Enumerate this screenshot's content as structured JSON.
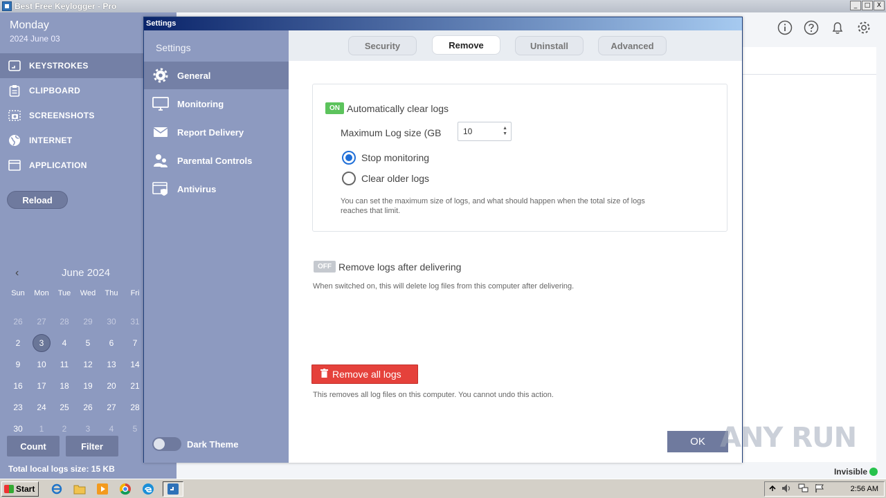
{
  "window": {
    "title": "Best Free Keylogger - Pro",
    "min": "_",
    "max": "□",
    "close": "X"
  },
  "sidebar": {
    "day": "Monday",
    "date": "2024 June 03",
    "items": [
      {
        "label": "KEYSTROKES",
        "icon": "keyboard-icon"
      },
      {
        "label": "CLIPBOARD",
        "icon": "clipboard-icon"
      },
      {
        "label": "SCREENSHOTS",
        "icon": "camera-icon"
      },
      {
        "label": "INTERNET",
        "icon": "globe-icon"
      },
      {
        "label": "APPLICATION",
        "icon": "window-icon"
      }
    ],
    "reload": "Reload",
    "count": "Count",
    "filter": "Filter",
    "total_size": "Total local logs size: 15 KB"
  },
  "calendar": {
    "title": "June 2024",
    "prev": "‹",
    "dow": [
      "Sun",
      "Mon",
      "Tue",
      "Wed",
      "Thu",
      "Fri"
    ],
    "weeks": [
      [
        "26",
        "27",
        "28",
        "29",
        "30",
        "31"
      ],
      [
        "2",
        "3",
        "4",
        "5",
        "6",
        "7"
      ],
      [
        "9",
        "10",
        "11",
        "12",
        "13",
        "14"
      ],
      [
        "16",
        "17",
        "18",
        "19",
        "20",
        "21"
      ],
      [
        "23",
        "24",
        "25",
        "26",
        "27",
        "28"
      ],
      [
        "30",
        "1",
        "2",
        "3",
        "4",
        "5"
      ]
    ],
    "selected": "3"
  },
  "dialog": {
    "title": "Settings",
    "side_title": "Settings",
    "items": [
      {
        "label": "General",
        "icon": "gear-icon"
      },
      {
        "label": "Monitoring",
        "icon": "monitor-icon"
      },
      {
        "label": "Report Delivery",
        "icon": "envelope-icon"
      },
      {
        "label": "Parental Controls",
        "icon": "users-icon"
      },
      {
        "label": "Antivirus",
        "icon": "shield-window-icon"
      }
    ],
    "dark_theme": "Dark Theme",
    "tabs": [
      "Security",
      "Remove",
      "Uninstall",
      "Advanced"
    ],
    "active_tab": "Remove",
    "auto_clear": {
      "badge": "ON",
      "label": "Automatically clear logs"
    },
    "max_log_label": "Maximum Log size (GB",
    "max_log_value": "10",
    "radio": [
      {
        "label": "Stop monitoring",
        "checked": true
      },
      {
        "label": "Clear older logs",
        "checked": false
      }
    ],
    "help1": "You can set the maximum size of logs, and what should happen when the total size of logs reaches that limit.",
    "remove_after": {
      "badge": "OFF",
      "label": "Remove logs after delivering"
    },
    "help2": "When switched on, this will delete log files from this computer after delivering.",
    "remove_all": "Remove all logs",
    "help3": "This removes all log files on this computer. You cannot undo this action.",
    "ok": "OK"
  },
  "status": {
    "invisible": "Invisible"
  },
  "watermark": "ANY RUN",
  "taskbar": {
    "start": "Start",
    "clock": "2:56 AM"
  },
  "colors": {
    "sidebar": "#8d9ac0",
    "active": "#7480a6",
    "on": "#5cc35c",
    "danger": "#e5413b",
    "accent": "#1f6fd8"
  }
}
